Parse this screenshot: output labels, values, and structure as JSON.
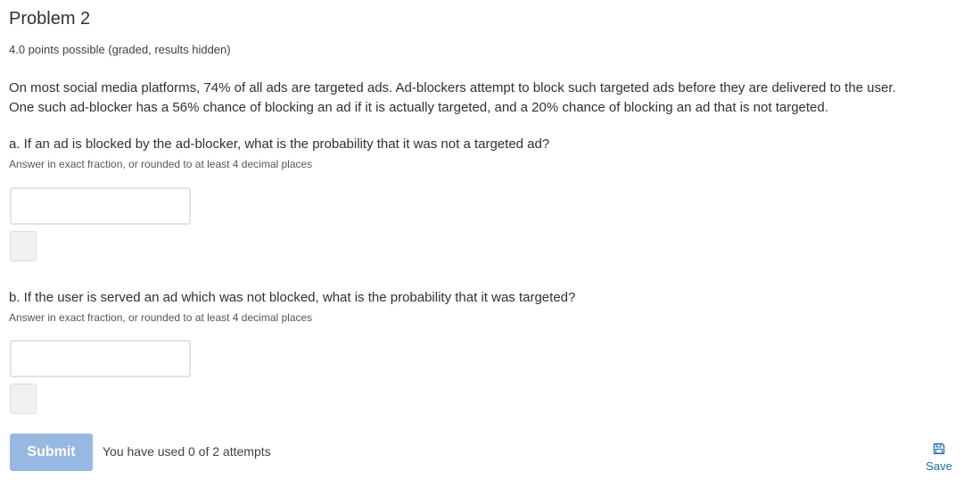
{
  "problem": {
    "title": "Problem 2",
    "points": "4.0 points possible (graded, results hidden)",
    "prompt_line_1": "On most social media platforms, 74% of all ads are targeted ads. Ad-blockers attempt to block such targeted ads before they are delivered to the user.",
    "prompt_line_2": "One such ad-blocker has a 56% chance of blocking an ad if it is actually targeted, and a 20% chance of blocking an ad that is not targeted."
  },
  "questions": [
    {
      "label": "a. If an ad is blocked by the ad-blocker, what is the probability that it was not a targeted ad?",
      "hint": "Answer in exact fraction, or rounded to at least 4 decimal places",
      "value": ""
    },
    {
      "label": "b. If the user is served an ad which was not blocked, what is the probability that it was targeted?",
      "hint": "Answer in exact fraction, or rounded to at least 4 decimal places",
      "value": ""
    }
  ],
  "actions": {
    "submit_label": "Submit",
    "attempts_text": "You have used 0 of 2 attempts",
    "save_label": "Save",
    "save_icon": "floppy-disk-icon",
    "accent_color": "#1d6ea8",
    "submit_color": "#97b8e0"
  }
}
